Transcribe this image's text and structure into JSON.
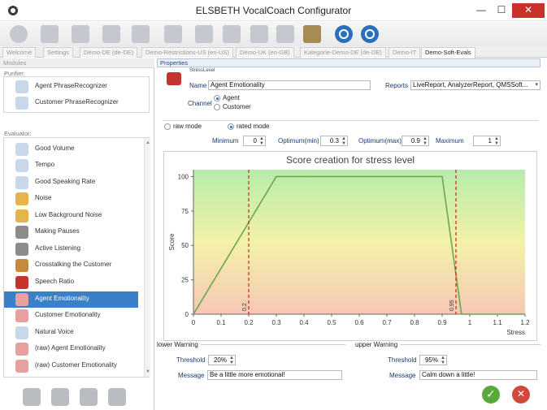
{
  "window": {
    "title": "ELSBETH VocalCoach Configurator",
    "minimize": "—",
    "maximize": "☐",
    "close": "✕"
  },
  "toolbar": {
    "icons": [
      "power-icon",
      "document-icon",
      "documents-icon",
      "image-icon",
      "trophy-icon",
      "module-add-icon",
      "module-copy-icon",
      "module-edit-icon",
      "module-settings-icon",
      "module-check-icon",
      "toolbox-icon",
      "help-icon",
      "info-icon"
    ]
  },
  "tabs": [
    {
      "label": "Welcome",
      "active": false
    },
    {
      "label": "Settings",
      "active": false
    },
    {
      "label": "Demo-DE (de-DE)",
      "active": false
    },
    {
      "label": "Demo-Restrictions-US (en-US)",
      "active": false
    },
    {
      "label": "Demo-UK (en-GB)",
      "active": false
    },
    {
      "label": "Kategorie-Demo-DE (de-DE)",
      "active": false
    },
    {
      "label": "Demo-IT",
      "active": false
    },
    {
      "label": "Demo-Soft-Evals",
      "active": true
    }
  ],
  "left": {
    "header": "Modules",
    "purifier_label": "Purifier:",
    "purifiers": [
      "Agent PhraseRecognizer",
      "Customer PhraseRecognizer"
    ],
    "evaluator_label": "Evaluator:",
    "evaluators": [
      "Good Volume",
      "Tempo",
      "Good Speaking Rate",
      "Noise",
      "Low Background Noise",
      "Making Pauses",
      "Active Listening",
      "Crosstalking the Customer",
      "Speech Ratio",
      "Agent Emotionality",
      "Customer Emotionality",
      "Natural Voice",
      "(raw) Agent Emotionality",
      "(raw) Customer Emotionality"
    ],
    "selected_evaluator": "Agent Emotionality"
  },
  "props": {
    "header": "Properties",
    "module_type": "StressLevel",
    "name_label": "Name",
    "name_value": "Agent Emotionality",
    "reports_label": "Reports",
    "reports_value": "LiveReport, AnalyzerReport, QMSSoft...",
    "channel_label": "Channel",
    "channel_options": [
      "Agent",
      "Customer"
    ],
    "channel_selected": "Agent",
    "raw_mode_label": "raw mode",
    "rated_mode_label": "rated mode",
    "mode_selected": "rated mode",
    "minimum_label": "Minimum",
    "minimum_value": "0",
    "optimum_min_label": "Optimum(min)",
    "optimum_min_value": "0.3",
    "optimum_max_label": "Optimum(max)",
    "optimum_max_value": "0.9",
    "maximum_label": "Maximum",
    "maximum_value": "1"
  },
  "chart_data": {
    "type": "line",
    "title": "Score creation for stress level",
    "xlabel": "Stress",
    "ylabel": "Score",
    "xlim": [
      0,
      1.2
    ],
    "ylim": [
      0,
      105
    ],
    "x_ticks": [
      "0",
      "0.1",
      "0.2",
      "0.3",
      "0.4",
      "0.5",
      "0.6",
      "0.7",
      "0.8",
      "0.9",
      "1",
      "1.1",
      "1.2"
    ],
    "x_tick_values": [
      0,
      0.1,
      0.2,
      0.3,
      0.4,
      0.5,
      0.6,
      0.7,
      0.8,
      0.9,
      1.0,
      1.1,
      1.2
    ],
    "y_ticks": [
      "0",
      "25",
      "50",
      "75",
      "100"
    ],
    "y_tick_values": [
      0,
      25,
      50,
      75,
      100
    ],
    "series": [
      {
        "x": [
          0,
          0.3,
          0.9,
          0.97,
          1.2
        ],
        "y": [
          0,
          100,
          100,
          0,
          0
        ],
        "color": "#6aa84f"
      }
    ],
    "threshold_lines": [
      {
        "x": 0.2,
        "label": "0.2",
        "color": "#d21c1c"
      },
      {
        "x": 0.95,
        "label": "0.95",
        "color": "#d21c1c"
      }
    ],
    "background_gradient": [
      "#b6ecab",
      "#f3f1a8",
      "#f6c7b5"
    ],
    "grid": false
  },
  "lower_warning": {
    "title": "lower Warning",
    "threshold_label": "Threshold",
    "threshold_value": "20%",
    "message_label": "Message",
    "message_value": "Be a little more emotional!"
  },
  "upper_warning": {
    "title": "upper Warning",
    "threshold_label": "Threshold",
    "threshold_value": "95%",
    "message_label": "Message",
    "message_value": "Calm down a little!"
  },
  "actions": {
    "ok": "OK",
    "cancel": "Cancel",
    "left_buttons": [
      "add-icon",
      "remove-icon",
      "edit-icon",
      "move-updown-icon"
    ]
  }
}
